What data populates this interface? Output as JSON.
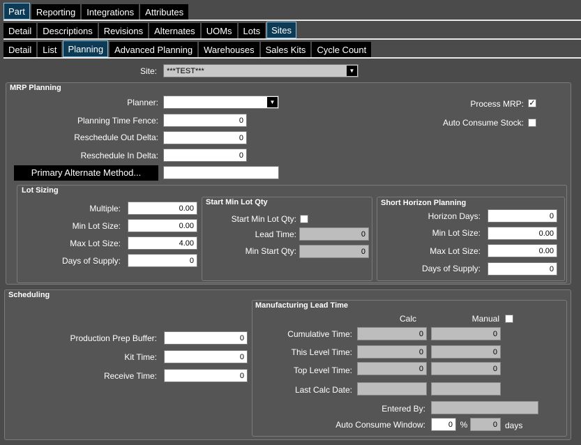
{
  "tabs_row1": [
    "Part",
    "Reporting",
    "Integrations",
    "Attributes"
  ],
  "tabs_row2": [
    "Detail",
    "Descriptions",
    "Revisions",
    "Alternates",
    "UOMs",
    "Lots",
    "Sites"
  ],
  "tabs_row3": [
    "Detail",
    "List",
    "Planning",
    "Advanced Planning",
    "Warehouses",
    "Sales Kits",
    "Cycle Count"
  ],
  "site": {
    "label": "Site:",
    "value": "***TEST***"
  },
  "mrp": {
    "title": "MRP Planning",
    "planner_label": "Planner:",
    "planner_value": "",
    "time_fence_label": "Planning Time Fence:",
    "time_fence_value": "0",
    "resched_out_label": "Reschedule Out Delta:",
    "resched_out_value": "0",
    "resched_in_label": "Reschedule In Delta:",
    "resched_in_value": "0",
    "primary_alt_button": "Primary Alternate Method...",
    "primary_alt_value": "",
    "process_mrp_label": "Process MRP:",
    "process_mrp_checked": "✓",
    "auto_consume_label": "Auto Consume Stock:",
    "auto_consume_checked": ""
  },
  "lot_sizing": {
    "title": "Lot Sizing",
    "multiple_label": "Multiple:",
    "multiple_value": "0.00",
    "min_lot_label": "Min Lot Size:",
    "min_lot_value": "0.00",
    "max_lot_label": "Max Lot Size:",
    "max_lot_value": "4.00",
    "days_supply_label": "Days of Supply:",
    "days_supply_value": "0"
  },
  "start_min_lot": {
    "title": "Start Min Lot Qty",
    "start_label": "Start Min Lot Qty:",
    "start_checked": "",
    "lead_time_label": "Lead Time:",
    "lead_time_value": "0",
    "min_start_label": "Min Start Qty:",
    "min_start_value": "0"
  },
  "short_horizon": {
    "title": "Short Horizon Planning",
    "horizon_days_label": "Horizon Days:",
    "horizon_days_value": "0",
    "min_lot_label": "Min Lot Size:",
    "min_lot_value": "0.00",
    "max_lot_label": "Max Lot Size:",
    "max_lot_value": "0.00",
    "days_supply_label": "Days of Supply:",
    "days_supply_value": "0"
  },
  "scheduling": {
    "title": "Scheduling",
    "prep_buffer_label": "Production Prep Buffer:",
    "prep_buffer_value": "0",
    "kit_time_label": "Kit Time:",
    "kit_time_value": "0",
    "receive_time_label": "Receive Time:",
    "receive_time_value": "0"
  },
  "mfg_lead": {
    "title": "Manufacturing Lead Time",
    "calc_header": "Calc",
    "manual_header": "Manual",
    "manual_checked": "",
    "cumulative_label": "Cumulative Time:",
    "cumulative_calc": "0",
    "cumulative_manual": "0",
    "this_level_label": "This Level Time:",
    "this_level_calc": "0",
    "this_level_manual": "0",
    "top_level_label": "Top Level Time:",
    "top_level_calc": "0",
    "top_level_manual": "0",
    "last_calc_label": "Last Calc Date:",
    "last_calc_calc": "",
    "last_calc_manual": "",
    "entered_by_label": "Entered By:",
    "entered_by_value": "",
    "window_label": "Auto Consume Window:",
    "window_pct_value": "0",
    "pct_symbol": "%",
    "window_days_value": "0",
    "days_label": "days"
  }
}
